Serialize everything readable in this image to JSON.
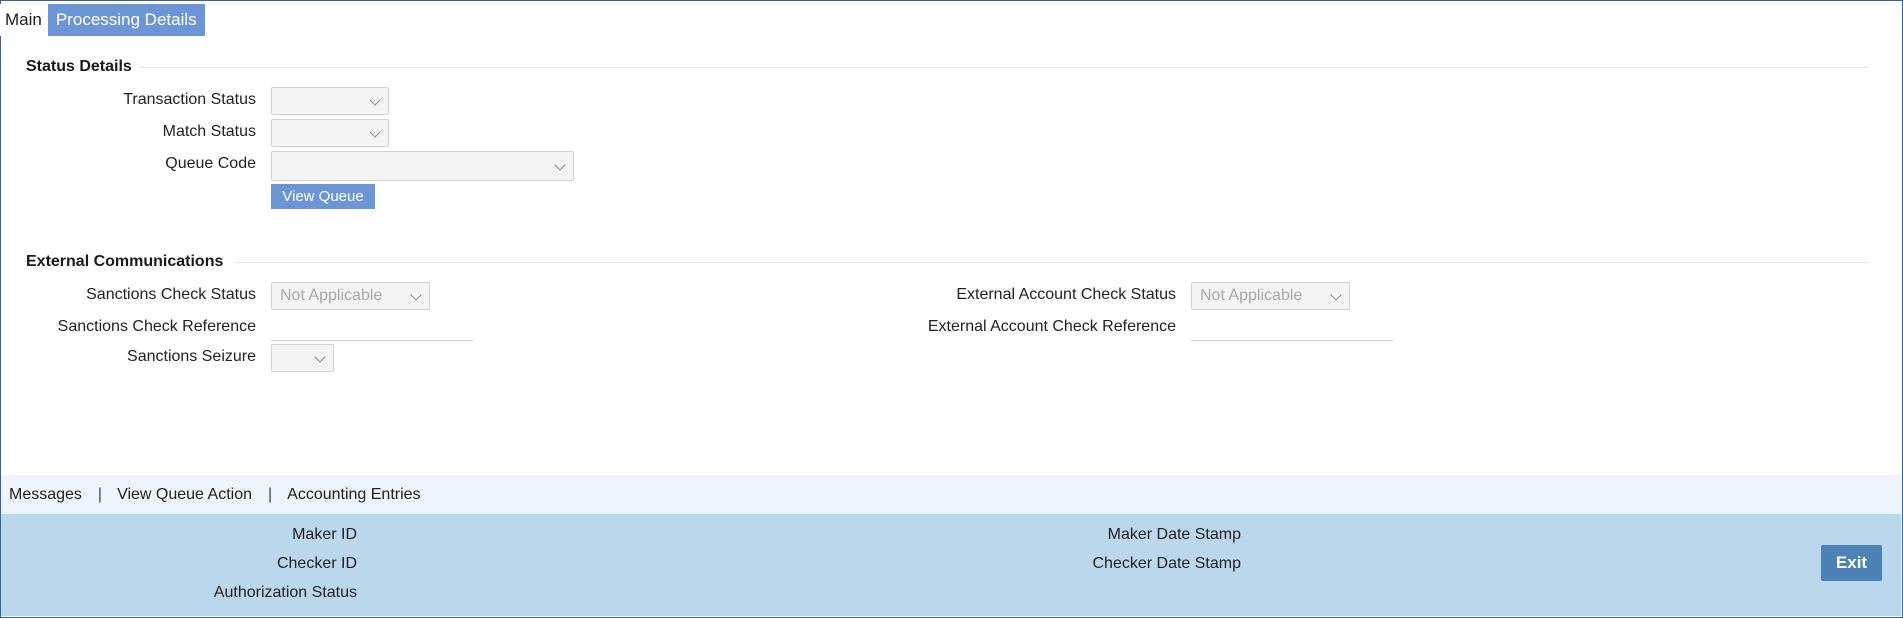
{
  "tabs": [
    {
      "label": "Main",
      "active": false
    },
    {
      "label": "Processing Details",
      "active": true
    }
  ],
  "status_details": {
    "title": "Status Details",
    "transaction_status_label": "Transaction Status",
    "transaction_status_value": "",
    "match_status_label": "Match Status",
    "match_status_value": "",
    "queue_code_label": "Queue Code",
    "queue_code_value": "",
    "view_queue_button": "View Queue"
  },
  "external_communications": {
    "title": "External Communications",
    "sanctions_check_status_label": "Sanctions Check Status",
    "sanctions_check_status_value": "Not Applicable",
    "sanctions_check_reference_label": "Sanctions Check Reference",
    "sanctions_check_reference_value": "",
    "sanctions_seizure_label": "Sanctions Seizure",
    "sanctions_seizure_value": "",
    "external_account_check_status_label": "External Account Check Status",
    "external_account_check_status_value": "Not Applicable",
    "external_account_check_reference_label": "External Account Check Reference",
    "external_account_check_reference_value": ""
  },
  "link_bar": {
    "items": [
      "Messages",
      "View Queue Action",
      "Accounting Entries"
    ],
    "separator": "|"
  },
  "audit": {
    "maker_id_label": "Maker ID",
    "checker_id_label": "Checker ID",
    "authorization_status_label": "Authorization Status",
    "maker_date_stamp_label": "Maker Date Stamp",
    "checker_date_stamp_label": "Checker Date Stamp",
    "exit_button": "Exit"
  },
  "icons": {
    "dropdown": "chevron-down-icon"
  },
  "colors": {
    "active_tab": "#6c95d6",
    "audit_background": "#bbd7ec",
    "link_bar_background": "#eef4fb",
    "exit_button": "#4c82b5",
    "frame_border": "#3d5f9a"
  }
}
